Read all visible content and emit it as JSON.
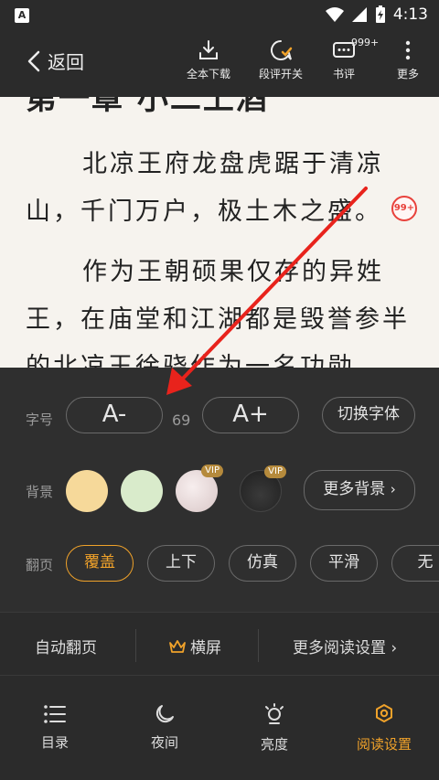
{
  "status_bar": {
    "app_icon_letter": "A",
    "time": "4:13"
  },
  "nav": {
    "back_label": "返回",
    "tools": [
      {
        "label": "全本下载",
        "icon": "download-icon"
      },
      {
        "label": "段评开关",
        "icon": "comment-toggle-icon"
      },
      {
        "label": "书评",
        "icon": "book-review-icon",
        "badge": "999+"
      },
      {
        "label": "更多",
        "icon": "more-icon"
      }
    ]
  },
  "reader": {
    "chapter_title": "第一章 小二上酒",
    "paragraphs": [
      "北凉王府龙盘虎踞于清凉山，千门万户，极土木之盛。",
      "作为王朝硕果仅存的异姓王，在庙堂和江湖都是毁誉参半的北凉王徐骁作为一名功勋"
    ],
    "comment_badge": "99+"
  },
  "settings": {
    "font_label": "字号",
    "font_decrease": "A-",
    "font_size_value": "69",
    "font_increase": "A+",
    "switch_font": "切换字体",
    "bg_label": "背景",
    "vip_tag": "VIP",
    "more_bg": "更多背景",
    "page_label": "翻页",
    "page_modes": [
      "覆盖",
      "上下",
      "仿真",
      "平滑",
      "无"
    ],
    "active_page_mode": "覆盖",
    "colors": {
      "bg1": "#f6d99a",
      "bg2": "#d9ebcb",
      "bg3": "#eadedd",
      "bg4": "#2a2a2a"
    }
  },
  "quick": {
    "auto_page": "自动翻页",
    "landscape": "横屏",
    "more_settings": "更多阅读设置"
  },
  "tabs": [
    {
      "label": "目录",
      "icon": "catalog-icon"
    },
    {
      "label": "夜间",
      "icon": "night-mode-icon"
    },
    {
      "label": "亮度",
      "icon": "brightness-icon"
    },
    {
      "label": "阅读设置",
      "icon": "read-settings-icon",
      "active": true
    }
  ],
  "accent_color": "#f0a22a"
}
